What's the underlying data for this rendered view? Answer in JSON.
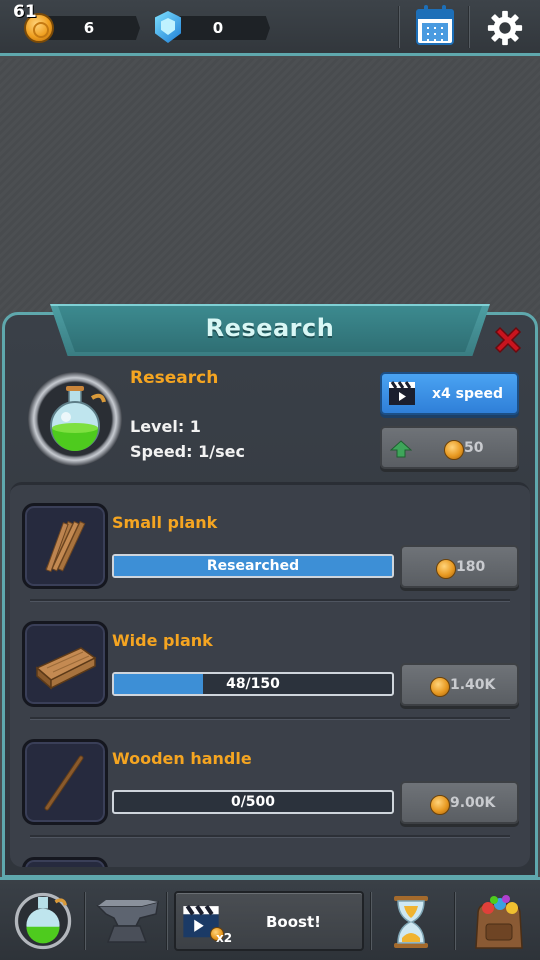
{
  "topbar": {
    "fps": "61",
    "coins": "6",
    "gems": "0",
    "icons": [
      "coin-icon",
      "gem-icon",
      "calendar-icon",
      "gear-icon"
    ]
  },
  "panel": {
    "title": "Research",
    "header": {
      "name": "Research",
      "level": "Level: 1",
      "speed": "Speed: 1/sec",
      "speed_button": "x4 speed",
      "upgrade_cost": "50"
    },
    "items": [
      {
        "name": "Small plank",
        "bar_text": "Researched",
        "progress": 1.0,
        "cost": "180"
      },
      {
        "name": "Wide plank",
        "bar_text": "48/150",
        "progress": 0.32,
        "cost": "1.40K"
      },
      {
        "name": "Wooden handle",
        "bar_text": "0/500",
        "progress": 0.0,
        "cost": "9.00K"
      }
    ]
  },
  "bottom_nav": {
    "boost_label": "Boost!",
    "boost_multiplier": "x2",
    "icons": [
      "potion-icon",
      "anvil-icon",
      "clapperboard-icon",
      "hourglass-icon",
      "backpack-icon"
    ]
  },
  "colors": {
    "accent_teal": "#5fa8ad",
    "item_name_orange": "#f5a521",
    "button_blue": "#3d8fd6",
    "close_red": "#c8141e"
  }
}
